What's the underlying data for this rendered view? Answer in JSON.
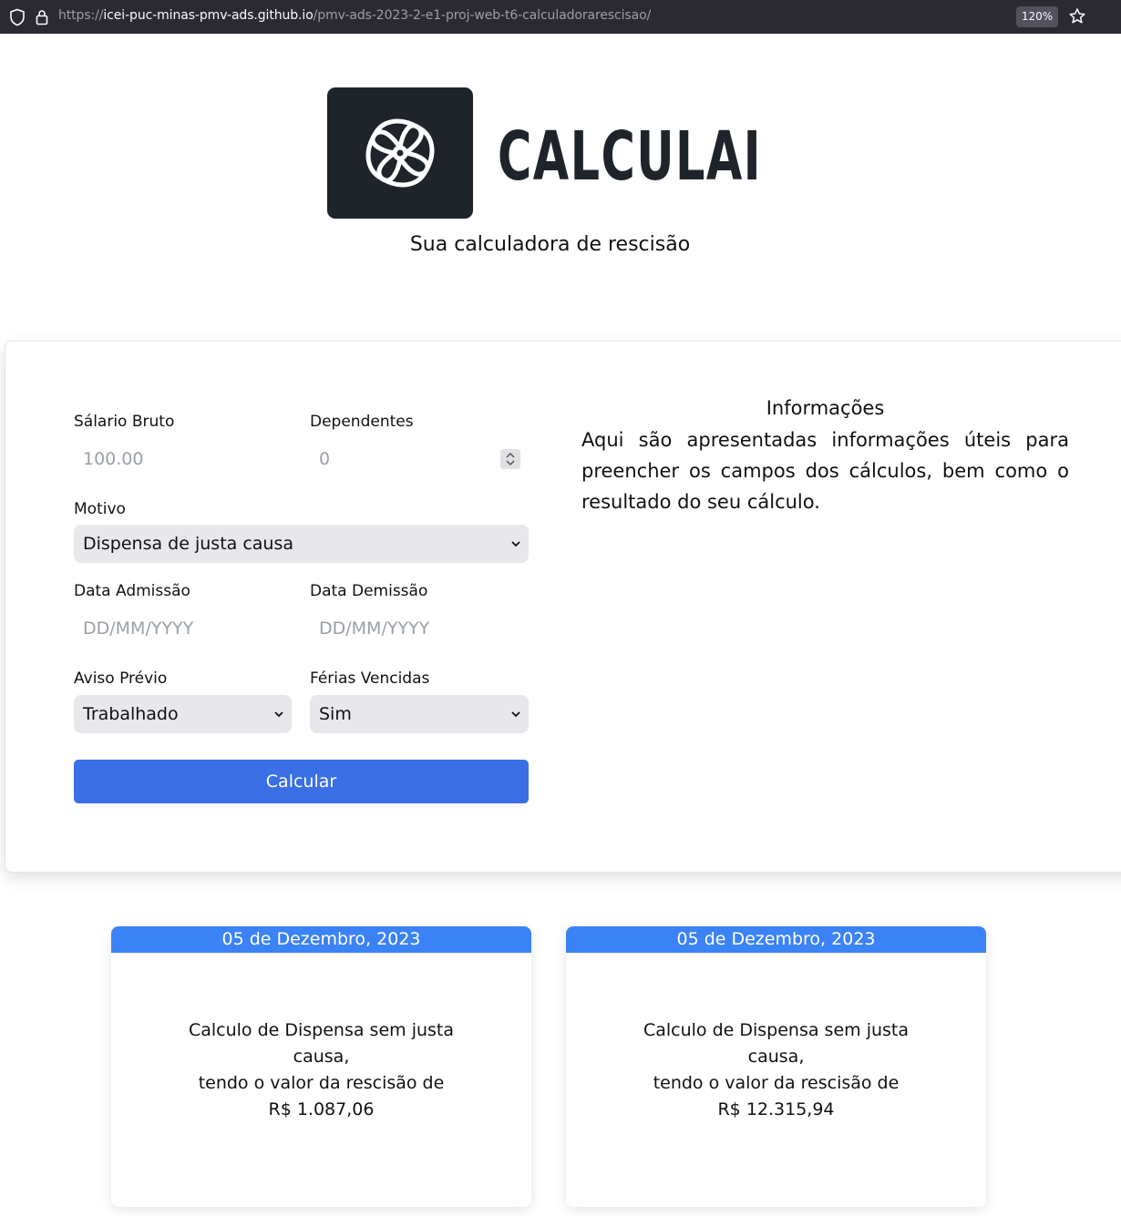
{
  "browser": {
    "url_prefix": "https://",
    "url_host": "icei-puc-minas-pmv-ads.github.io",
    "url_path": "/pmv-ads-2023-2-e1-proj-web-t6-calculadorarescisao/",
    "zoom": "120%"
  },
  "header": {
    "logo_text": "CALCULAI",
    "subtitle": "Sua calculadora de rescisão"
  },
  "form": {
    "salario_label": "Sálario Bruto",
    "salario_placeholder": "100.00",
    "dependentes_label": "Dependentes",
    "dependentes_placeholder": "0",
    "motivo_label": "Motivo",
    "motivo_value": "Dispensa de justa causa",
    "admissao_label": "Data Admissão",
    "admissao_placeholder": "DD/MM/YYYY",
    "demissao_label": "Data Demissão",
    "demissao_placeholder": "DD/MM/YYYY",
    "aviso_label": "Aviso Prévio",
    "aviso_value": "Trabalhado",
    "ferias_label": "Férias Vencidas",
    "ferias_value": "Sim",
    "submit_label": "Calcular"
  },
  "info": {
    "title": "Informações",
    "text": "Aqui são apresentadas informações úteis para preencher os campos dos cálculos, bem como o resultado do seu cálculo."
  },
  "results": [
    {
      "date": "05 de Dezembro, 2023",
      "line1": "Calculo de Dispensa sem justa",
      "line2": "causa,",
      "line3": "tendo o valor da rescisão de",
      "line4": "R$ 1.087,06"
    },
    {
      "date": "05 de Dezembro, 2023",
      "line1": "Calculo de Dispensa sem justa",
      "line2": "causa,",
      "line3": "tendo o valor da rescisão de",
      "line4": "R$ 12.315,94"
    }
  ],
  "colors": {
    "primary_button": "#3b6fe6",
    "card_header": "#3b82f6",
    "logo_bg": "#1f242b"
  }
}
